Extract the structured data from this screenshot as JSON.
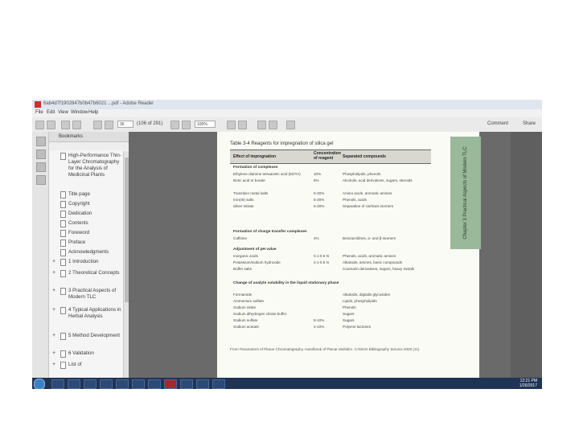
{
  "window": {
    "title": "6ab4d7f1902847b0b47b6021 ...pdf - Adobe Reader",
    "menu": [
      "File",
      "Edit",
      "View",
      "Window",
      "Help"
    ]
  },
  "toolbar": {
    "page_value": "36",
    "page_count": "(106 of 291)",
    "zoom_value": "100%",
    "comment_label": "Comment",
    "share_label": "Share"
  },
  "sidebar": {
    "header": "Bookmarks",
    "items": [
      {
        "label": "High-Performance Thin-Layer Chromatography for the Analysis of Medicinal Plants",
        "expandable": false
      },
      {
        "label": "Title page",
        "expandable": false
      },
      {
        "label": "Copyright",
        "expandable": false
      },
      {
        "label": "Dedication",
        "expandable": false
      },
      {
        "label": "Contents",
        "expandable": false
      },
      {
        "label": "Foreword",
        "expandable": false
      },
      {
        "label": "Preface",
        "expandable": false
      },
      {
        "label": "Acknowledgments",
        "expandable": false
      },
      {
        "label": "1 Introduction",
        "expandable": true
      },
      {
        "label": "2 Theoretical Concepts",
        "expandable": true
      },
      {
        "label": "3 Practical Aspects of Modern TLC",
        "expandable": true
      },
      {
        "label": "4 Typical Applications in Herbal Analysis",
        "expandable": true
      },
      {
        "label": "5 Method Development",
        "expandable": true
      },
      {
        "label": "6 Validation",
        "expandable": true
      },
      {
        "label": "List of",
        "expandable": false
      }
    ]
  },
  "document": {
    "table_title": "Table 3-4  Reagents for impregnation of silica gel",
    "chapter_tab": "Chapter 3  Practical Aspects of Modern TLC",
    "headers": [
      "Effect of impregnation",
      "Concentration of reagent",
      "Separated compounds"
    ],
    "sections": [
      {
        "title": "Formation of complexes",
        "rows": [
          [
            "Ethylene diamine tetraacetic acid (EDTA)",
            "10%",
            "Phospholipids, phenols"
          ],
          [
            "Boric acid or borate",
            "5%",
            "Alcohols, acid derivatives, sugars, steroids"
          ],
          [
            "Transition metal salts",
            "5-20%",
            "Amino acids, aromatic amines"
          ],
          [
            "Iron(III) salts",
            "5-20%",
            "Phenols, acids"
          ],
          [
            "Silver nitrate",
            "5-20%",
            "Separation of cis/trans isomers"
          ]
        ]
      },
      {
        "title": "Formation of charge transfer complexes",
        "rows": [
          [
            "Caffeine",
            "4%",
            "Benzacridines, α- and β-isomers"
          ]
        ]
      },
      {
        "title": "Adjustment of pH value",
        "rows": [
          [
            "Inorganic acids",
            "0.1-0.5 N",
            "Phenols, acids, aromatic amines"
          ],
          [
            "Potassium/sodium hydroxide",
            "0.1-0.5 N",
            "Alkaloids, amines, basic compounds"
          ],
          [
            "Buffer salts",
            "",
            "Coumarin derivatives, sugars, heavy metals"
          ]
        ]
      },
      {
        "title": "Change of analyte solubility in the liquid stationary phase",
        "rows": [
          [
            "Formamide",
            "",
            "Alkaloids, digitalis glycosides"
          ],
          [
            "Ammonium sulfate",
            "",
            "Lipids, phospholipids"
          ],
          [
            "Sodium nitrite",
            "",
            "Phenols"
          ],
          [
            "Sodium dihydrogen citrate buffer",
            "",
            "Sugars"
          ],
          [
            "Sodium sulfate",
            "8-10%",
            "Sugars"
          ],
          [
            "Sodium acetate",
            "4-10%",
            "Polyene lactones"
          ]
        ]
      }
    ],
    "caption": "From Parameters of Planar Chromatography. Handbook of Planar Multidim. CAMAG Bibliography Service 2000 (11)."
  },
  "taskbar": {
    "time": "12:21 PM",
    "date": "1/26/2017"
  }
}
